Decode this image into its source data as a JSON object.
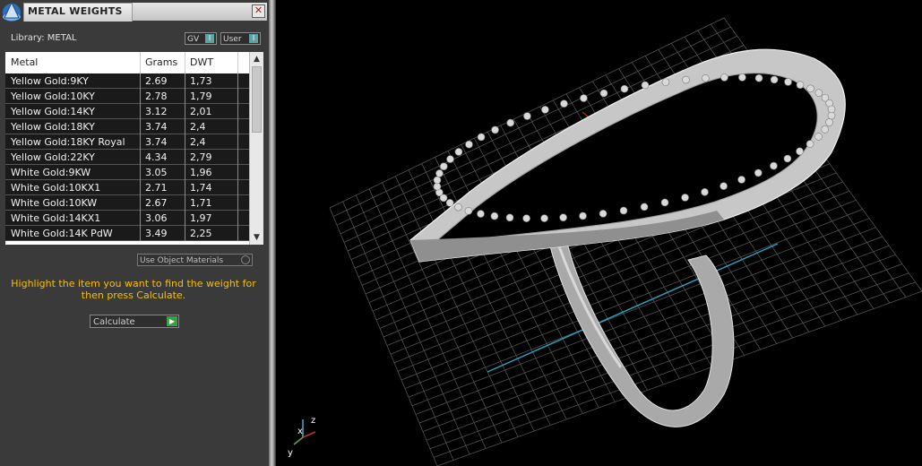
{
  "panel": {
    "title": "METAL WEIGHTS",
    "close_glyph": "✕",
    "library_label": "Library: METAL",
    "toggles": [
      {
        "label": "GV",
        "indicator": "I"
      },
      {
        "label": "User",
        "indicator": "I"
      }
    ],
    "table": {
      "headers": [
        "Metal",
        "Grams",
        "DWT"
      ],
      "rows": [
        {
          "metal": "Yellow Gold:9KY",
          "grams": "2.69",
          "dwt": "1,73"
        },
        {
          "metal": "Yellow Gold:10KY",
          "grams": "2.78",
          "dwt": "1,79"
        },
        {
          "metal": "Yellow Gold:14KY",
          "grams": "3.12",
          "dwt": "2,01"
        },
        {
          "metal": "Yellow Gold:18KY",
          "grams": "3.74",
          "dwt": "2,4"
        },
        {
          "metal": "Yellow Gold:18KY Royal",
          "grams": "3.74",
          "dwt": "2,4"
        },
        {
          "metal": "Yellow Gold:22KY",
          "grams": "4.34",
          "dwt": "2,79"
        },
        {
          "metal": "White Gold:9KW",
          "grams": "3.05",
          "dwt": "1,96"
        },
        {
          "metal": "White Gold:10KX1",
          "grams": "2.71",
          "dwt": "1,74"
        },
        {
          "metal": "White Gold:10KW",
          "grams": "2.67",
          "dwt": "1,71"
        },
        {
          "metal": "White Gold:14KX1",
          "grams": "3.06",
          "dwt": "1,97"
        },
        {
          "metal": "White Gold:14K PdW",
          "grams": "3.49",
          "dwt": "2,25"
        }
      ],
      "scroll_up": "▲",
      "scroll_down": "▼"
    },
    "use_object_materials": "Use Object Materials",
    "hint": "Highlight the item you want to find the weight for then press Calculate.",
    "calculate_label": "Calculate",
    "calculate_go": "▶"
  },
  "viewport": {
    "axis_labels": {
      "z": "z",
      "x": "x",
      "y": "y"
    },
    "background": "#000000",
    "grid_color": "#5a5a5a",
    "x_axis_color": "#c02020",
    "y_axis_color": "#2aa0c0",
    "model_color": "#b8b8b8"
  }
}
